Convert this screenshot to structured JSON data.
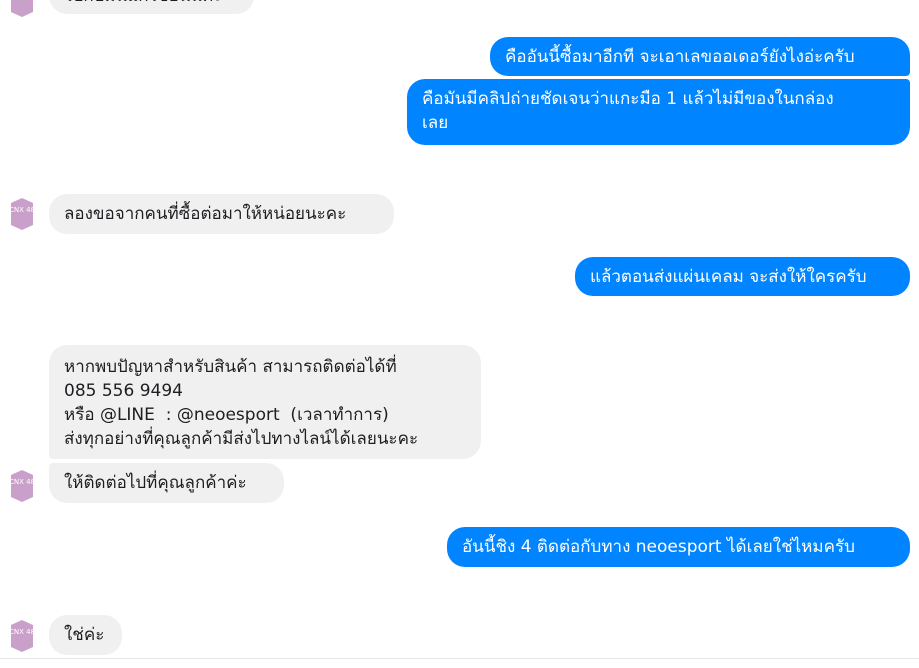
{
  "avatar_label": "CNX 48",
  "messages": [
    {
      "direction": "incoming",
      "text": "ไปกับมันแก้ไขอันนี้ค่ะ"
    },
    {
      "direction": "outgoing",
      "text": "คืออันนี้ซื้อมาอีกที จะเอาเลขออเดอร์ยังไงอ่ะครับ"
    },
    {
      "direction": "outgoing",
      "text": "คือมันมีคลิปถ่ายชัดเจนว่าแกะมือ 1 แล้วไม่มีของในกล่อง\nเลย"
    },
    {
      "direction": "incoming",
      "text": "ลองขอจากคนที่ซื้อต่อมาให้หน่อยนะคะ"
    },
    {
      "direction": "outgoing",
      "text": "แล้วตอนส่งแผ่นเคลม จะส่งให้ใครครับ"
    },
    {
      "direction": "incoming",
      "text": "หากพบปัญหาสำหรับสินค้า สามารถติดต่อได้ที่\n085 556 9494\nหรือ @LINE  : @neoesport  (เวลาทำการ)\nส่งทุกอย่างที่คุณลูกค้ามีส่งไปทางไลน์ได้เลยนะคะ"
    },
    {
      "direction": "incoming",
      "text": "ให้ติดต่อไปที่คุณลูกค้าค่ะ"
    },
    {
      "direction": "outgoing",
      "text": "อันนี้ชิง 4 ติดต่อกับทาง neoesport ได้เลยใช่ไหมครับ"
    },
    {
      "direction": "incoming",
      "text": "ใช่ค่ะ"
    }
  ],
  "colors": {
    "outgoing_bubble": "#0084ff",
    "incoming_bubble": "#f0f0f0",
    "avatar": "#c9a0c9"
  }
}
